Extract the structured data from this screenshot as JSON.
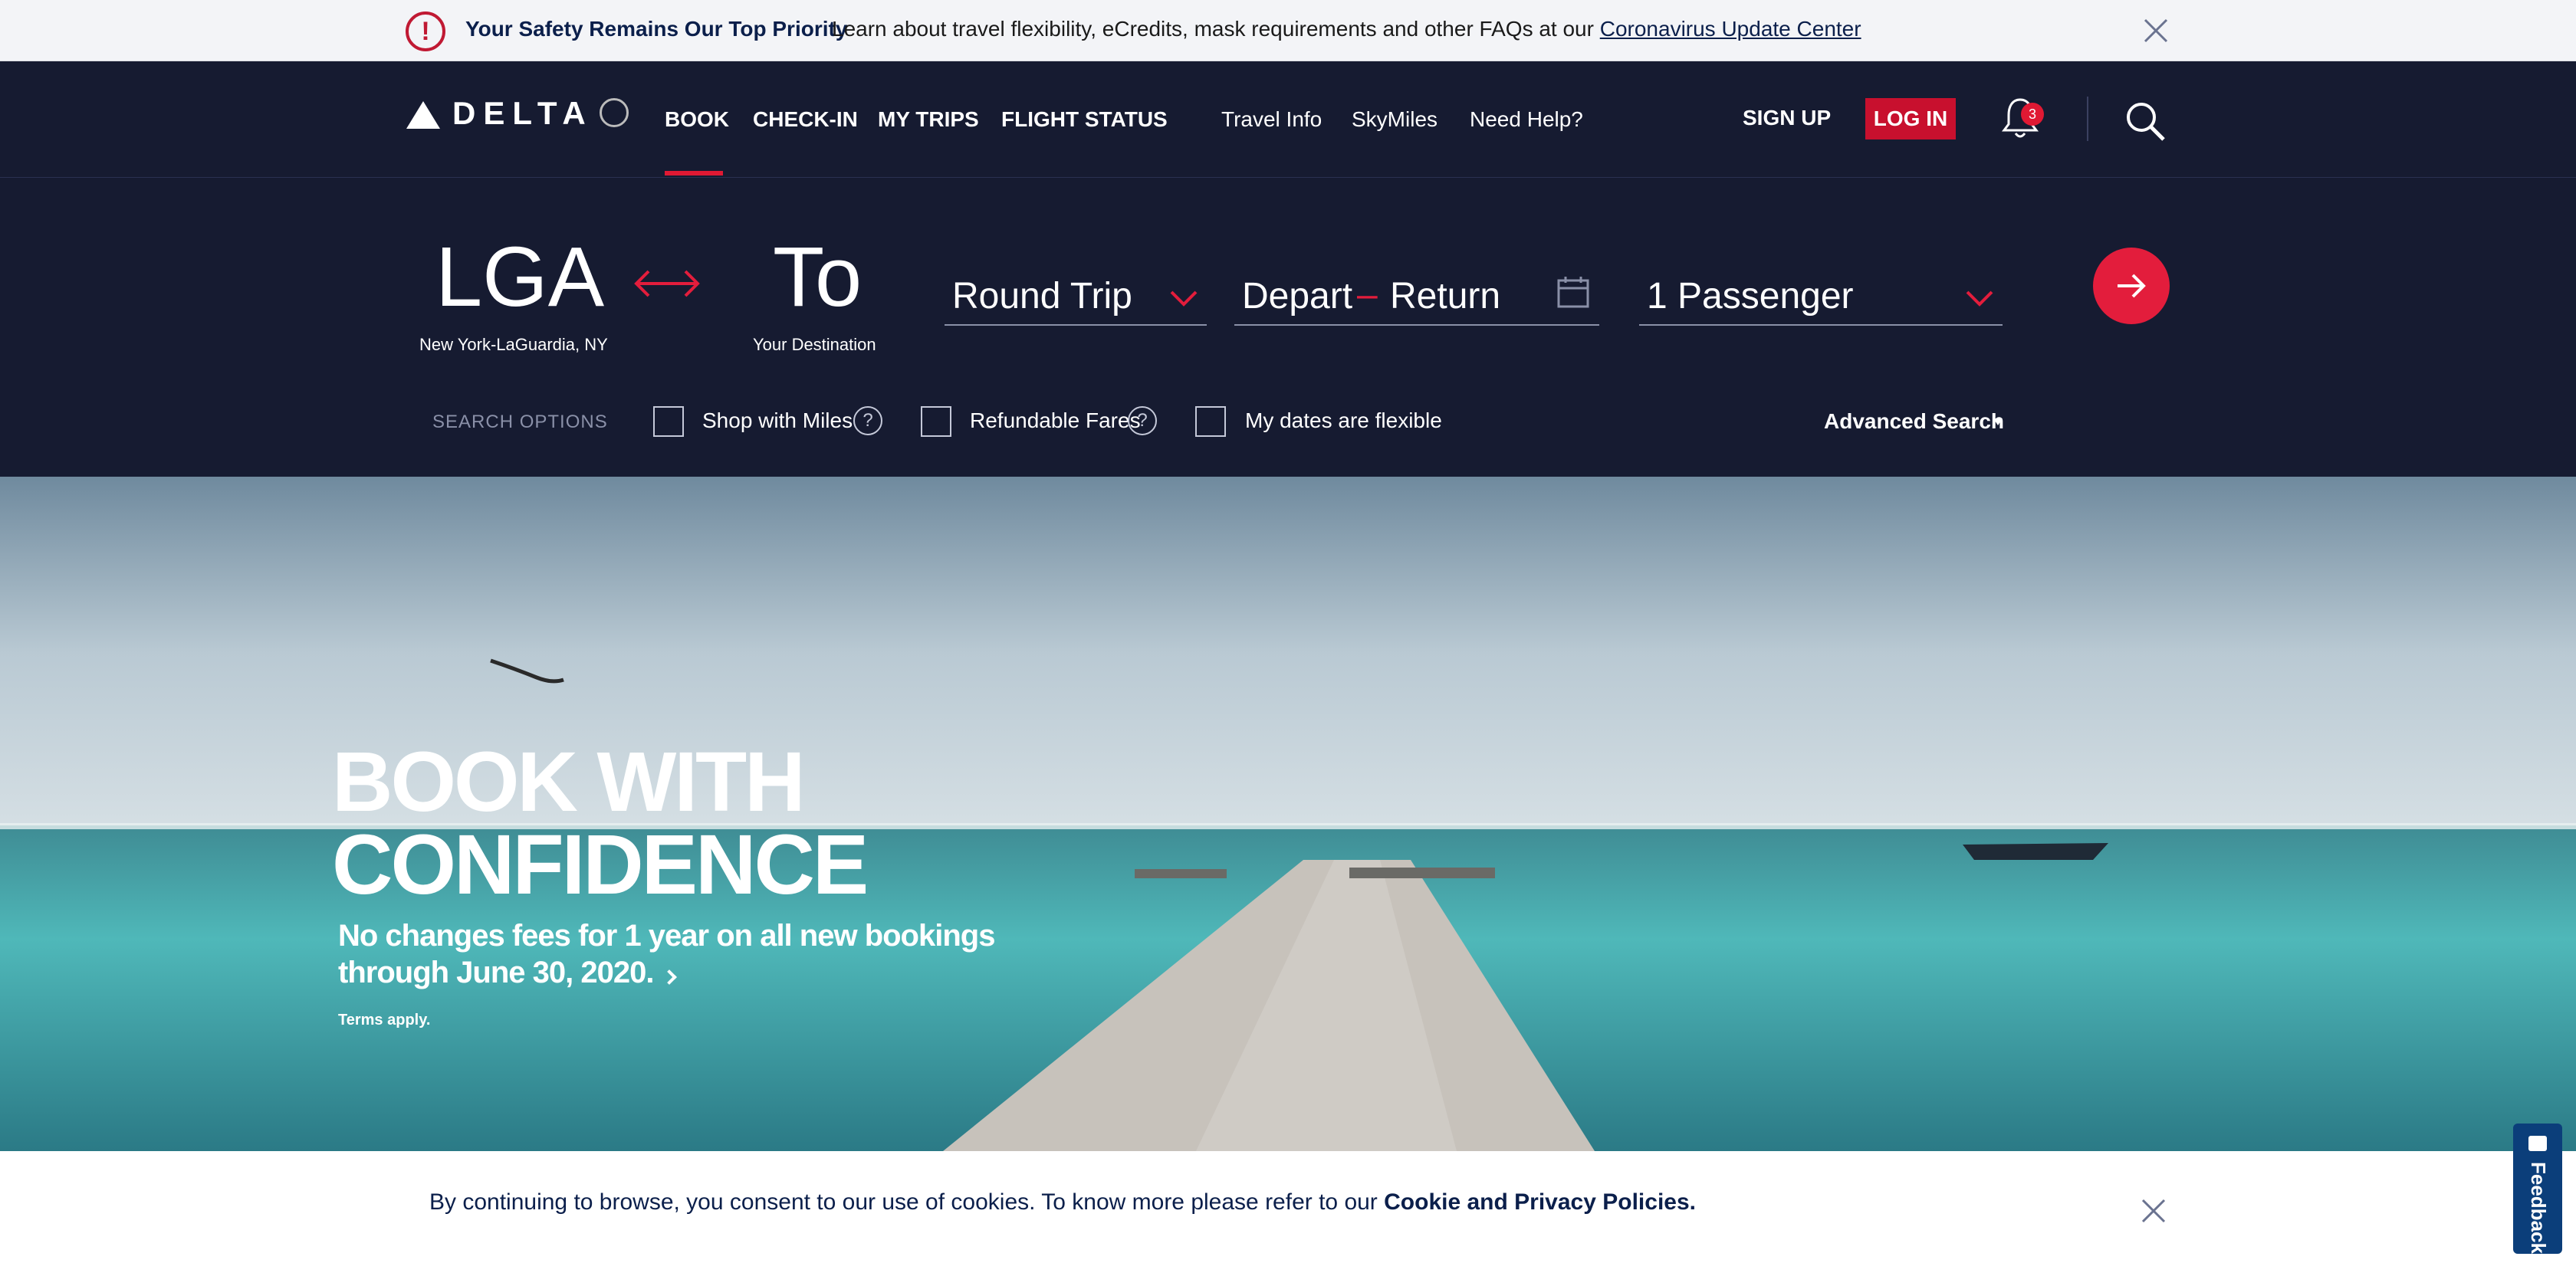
{
  "alert": {
    "title": "Your Safety Remains Our Top Priority",
    "message": "Learn about travel flexibility, eCredits, mask requirements and other FAQs at our ",
    "link": "Coronavirus Update Center"
  },
  "header": {
    "logo_text": "DELTA",
    "nav_primary": [
      "BOOK",
      "CHECK-IN",
      "MY TRIPS",
      "FLIGHT STATUS"
    ],
    "nav_secondary": [
      "Travel Info",
      "SkyMiles",
      "Need Help?"
    ],
    "signup": "SIGN UP",
    "login": "LOG IN",
    "notifications": "3"
  },
  "booking": {
    "from_code": "LGA",
    "from_name": "New York-LaGuardia, NY",
    "to_code": "To",
    "to_name": "Your Destination",
    "trip_type": "Round Trip",
    "depart": "Depart",
    "dash": "–",
    "return": "Return",
    "passengers": "1 Passenger",
    "search_options": "SEARCH OPTIONS",
    "opt_miles": "Shop with Miles",
    "opt_refundable": "Refundable Fares",
    "opt_flexible": "My dates are flexible",
    "advanced": "Advanced Search"
  },
  "hero": {
    "title_line1": "BOOK WITH",
    "title_line2": "CONFIDENCE",
    "subtitle": "No changes fees for 1 year on all new bookings through June 30, 2020.",
    "terms": "Terms apply."
  },
  "cookie": {
    "text": "By continuing to browse, you consent to our use of cookies. To know more please refer to our ",
    "link": "Cookie and Privacy Policies."
  },
  "feedback": "Feedback",
  "colors": {
    "navy": "#161b31",
    "red": "#e31d3c",
    "alert_red": "#c01933"
  }
}
